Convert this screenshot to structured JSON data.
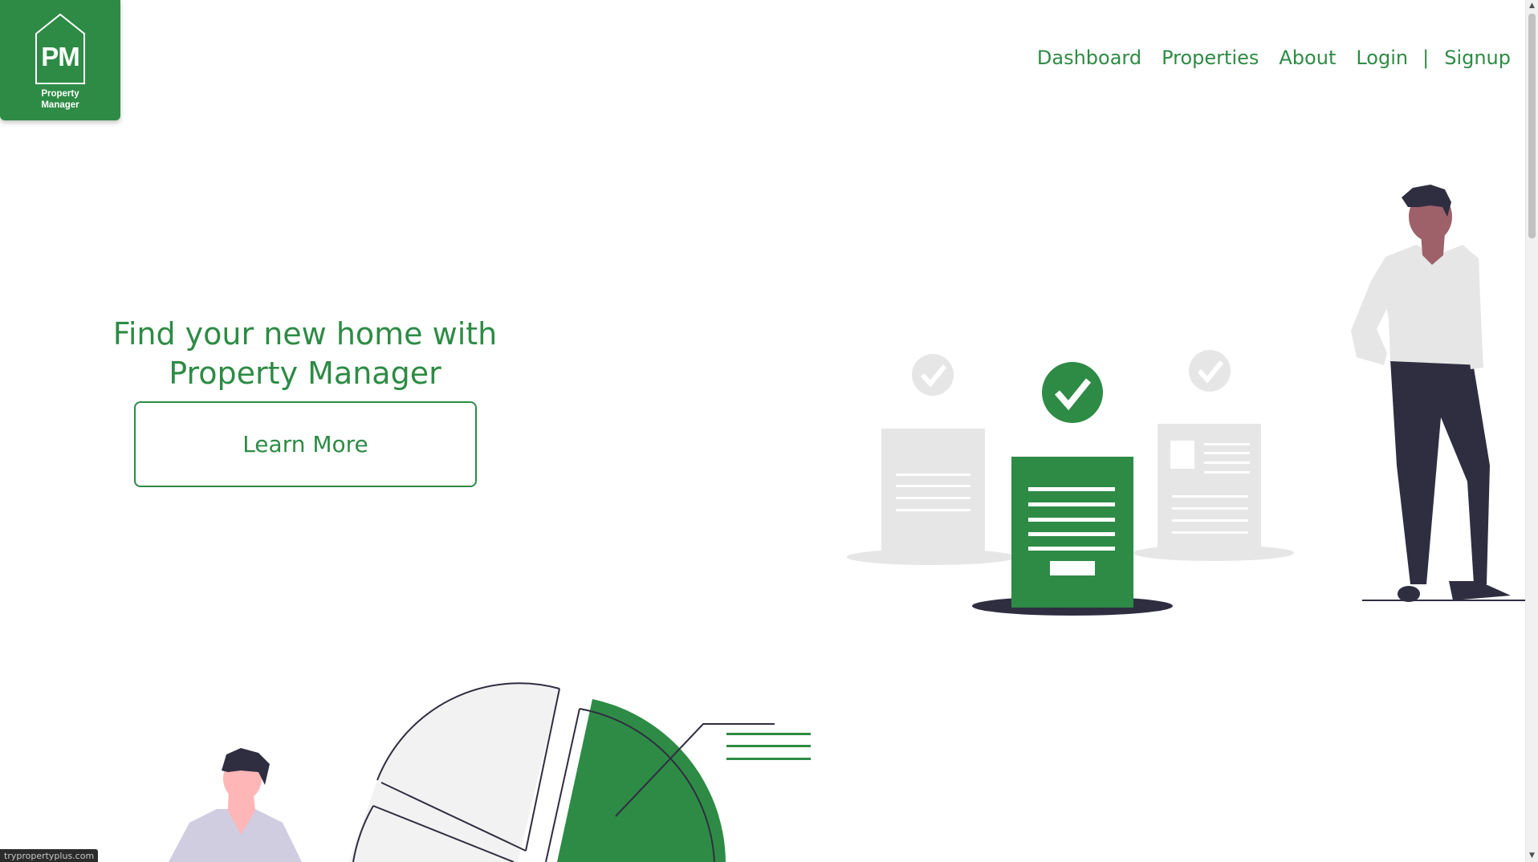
{
  "logo": {
    "initials": "PM",
    "name_line1": "Property",
    "name_line2": "Manager"
  },
  "nav": {
    "items": [
      "Dashboard",
      "Properties",
      "About",
      "Login",
      "Signup"
    ],
    "separator": "|"
  },
  "hero": {
    "heading_line1": "Find your new home with",
    "heading_line2": "Property Manager",
    "button_label": "Learn More"
  },
  "status_bar": {
    "url": "trypropertyplus.com"
  },
  "colors": {
    "brand_green": "#2e8b45",
    "light_gray": "#e6e6e6",
    "dark_navy": "#2f2e41",
    "skin_dark": "#9e616a",
    "skin_light": "#ffb6b6"
  }
}
